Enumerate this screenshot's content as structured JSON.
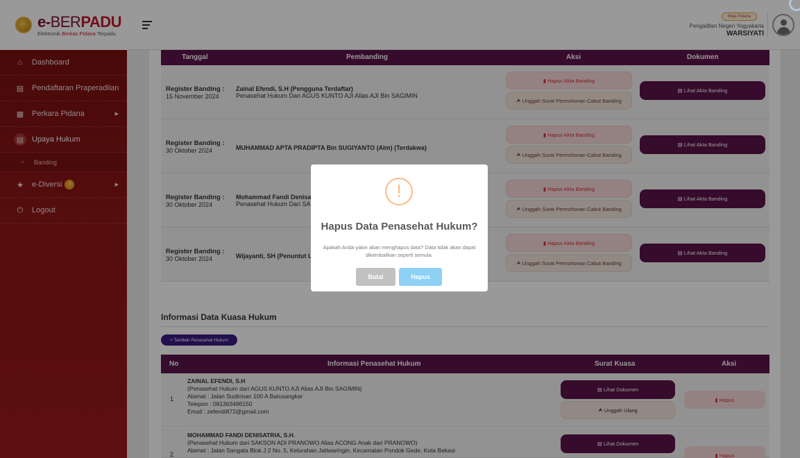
{
  "header": {
    "brand_prefix": "e-",
    "brand_thin": "BER",
    "brand_bold": "PADU",
    "tagline_1": "Elektronik ",
    "tagline_2": "Berkas Pidana",
    "tagline_3": " Terpadu",
    "role_badge": "Meja Pidana",
    "court": "Pengadilan Negeri Yogyakarta",
    "username": "WARSIYATI"
  },
  "sidebar": {
    "items": [
      {
        "label": "Dashboard",
        "icon": "home-icon"
      },
      {
        "label": "Pendaftaran Praperadilan",
        "icon": "document-icon"
      },
      {
        "label": "Perkara Pidana",
        "icon": "folder-icon"
      },
      {
        "label": "Upaya Hukum",
        "icon": "document-icon"
      },
      {
        "label": "e-Diversi",
        "icon": "star-icon",
        "badge": "3"
      },
      {
        "label": "Logout",
        "icon": "power-icon"
      }
    ],
    "sub_banding": "Banding"
  },
  "banding_table": {
    "columns": [
      "Tanggal",
      "Pembanding",
      "Aksi",
      "Dokumen"
    ],
    "rows": [
      {
        "reg_label": "Register Banding :",
        "date": "15 November 2024",
        "name": "Zainal Efendi, S.H (Pengguna Terdaftar)",
        "sub": "Penasehat Hukum Dari AGUS KUNTO AJI Alias AJI Bin SAGIMIN"
      },
      {
        "reg_label": "Register Banding :",
        "date": "30 Oktober 2024",
        "name": "MUHAMMAD APTA PRADIPTA Bin SUGIYANTO (Alm) (Terdakwa)",
        "sub": ""
      },
      {
        "reg_label": "Register Banding :",
        "date": "30 Oktober 2024",
        "name": "Mohammad Fandi Denisa",
        "sub": "Penasehat Hukum Dari SAK"
      },
      {
        "reg_label": "Register Banding :",
        "date": "30 Oktober 2024",
        "name": "Wijayanti, SH (Penuntut U",
        "sub": ""
      }
    ],
    "btn_hapus_akta": "Hapus Akta Banding",
    "btn_unggah": "Unggah Surat Permohonan Cabut Banding",
    "btn_lihat_akta": "Lihat Akta Banding"
  },
  "kuasa": {
    "title": "Informasi Data Kuasa Hukum",
    "btn_tambah": "+ Tambah Penasehat Hukum",
    "columns": [
      "No",
      "Informasi Penasehat Hukum",
      "Surat Kuasa",
      "Aksi"
    ],
    "rows": [
      {
        "no": "1",
        "name": "ZAINAL EFENDI, S.H",
        "line1": "(Penasehat Hukum dari AGUS KUNTO AJI Alias AJI Bin SAGIMIN)",
        "line2": "Alamat : Jalan Sudirman 100 A Batusangkar",
        "line3": "Telepon : 081363486150",
        "line4": "Email : zefendi872@gmail.com"
      },
      {
        "no": "2",
        "name": "MOHAMMAD FANDI DENISATRIA, S.H.",
        "line1": "(Penasehat Hukum dari SAKSON ADI PRANOWO Alias ACONG Anak dari PRANOWO)",
        "line2": "Alamat : Jalan Sangata Blok J 2 No. 5, Kelurahan Jatiwaringin, Kecamatan Pondok Gede, Kota Bekasi",
        "line3": "",
        "line4": ""
      }
    ],
    "btn_lihat_dok": "Lihat Dokumen",
    "btn_unggah_ulang": "Unggah Ulang",
    "btn_hapus": "Hapus"
  },
  "modal": {
    "icon": "!",
    "title": "Hapus Data Penasehat Hukum?",
    "text": "Apakah Anda yakin akan menghapus data? Data tidak akan dapat dikembalikan seperti semula.",
    "btn_cancel": "Batal",
    "btn_confirm": "Hapus"
  }
}
